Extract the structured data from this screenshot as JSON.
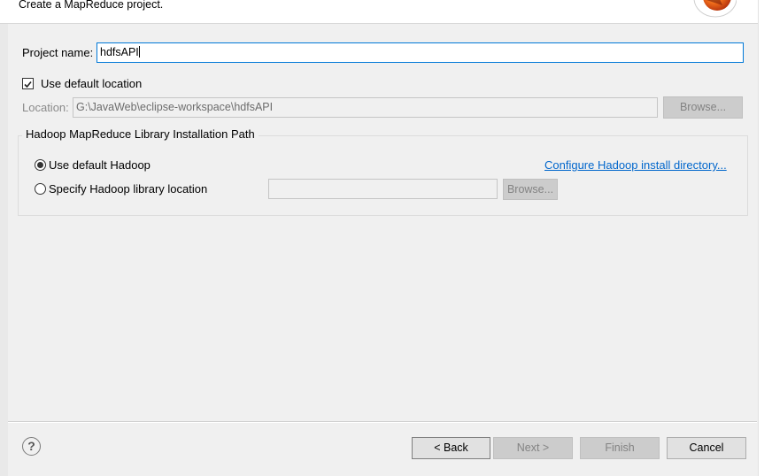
{
  "header": {
    "description": "Create a MapReduce project."
  },
  "project": {
    "name_label": "Project name:",
    "name_value": "hdfsAPI",
    "use_default_location_label": "Use default location",
    "use_default_location_checked": true,
    "location_label": "Location:",
    "location_value": "G:\\JavaWeb\\eclipse-workspace\\hdfsAPI",
    "browse_label": "Browse..."
  },
  "hadoop_group": {
    "title": "Hadoop MapReduce Library Installation Path",
    "use_default_label": "Use default Hadoop",
    "use_default_selected": true,
    "configure_link": "Configure Hadoop install directory...",
    "specify_label": "Specify Hadoop library location",
    "specify_value": "",
    "browse_label": "Browse..."
  },
  "footer": {
    "help_symbol": "?",
    "back_label": "< Back",
    "next_label": "Next >",
    "finish_label": "Finish",
    "cancel_label": "Cancel"
  },
  "icons": {
    "header_logo": "mapreduce-wizard-logo",
    "help": "help-icon"
  },
  "colors": {
    "focus_border": "#0078d7",
    "link": "#0066cc",
    "window_bg": "#f0f0f0"
  }
}
